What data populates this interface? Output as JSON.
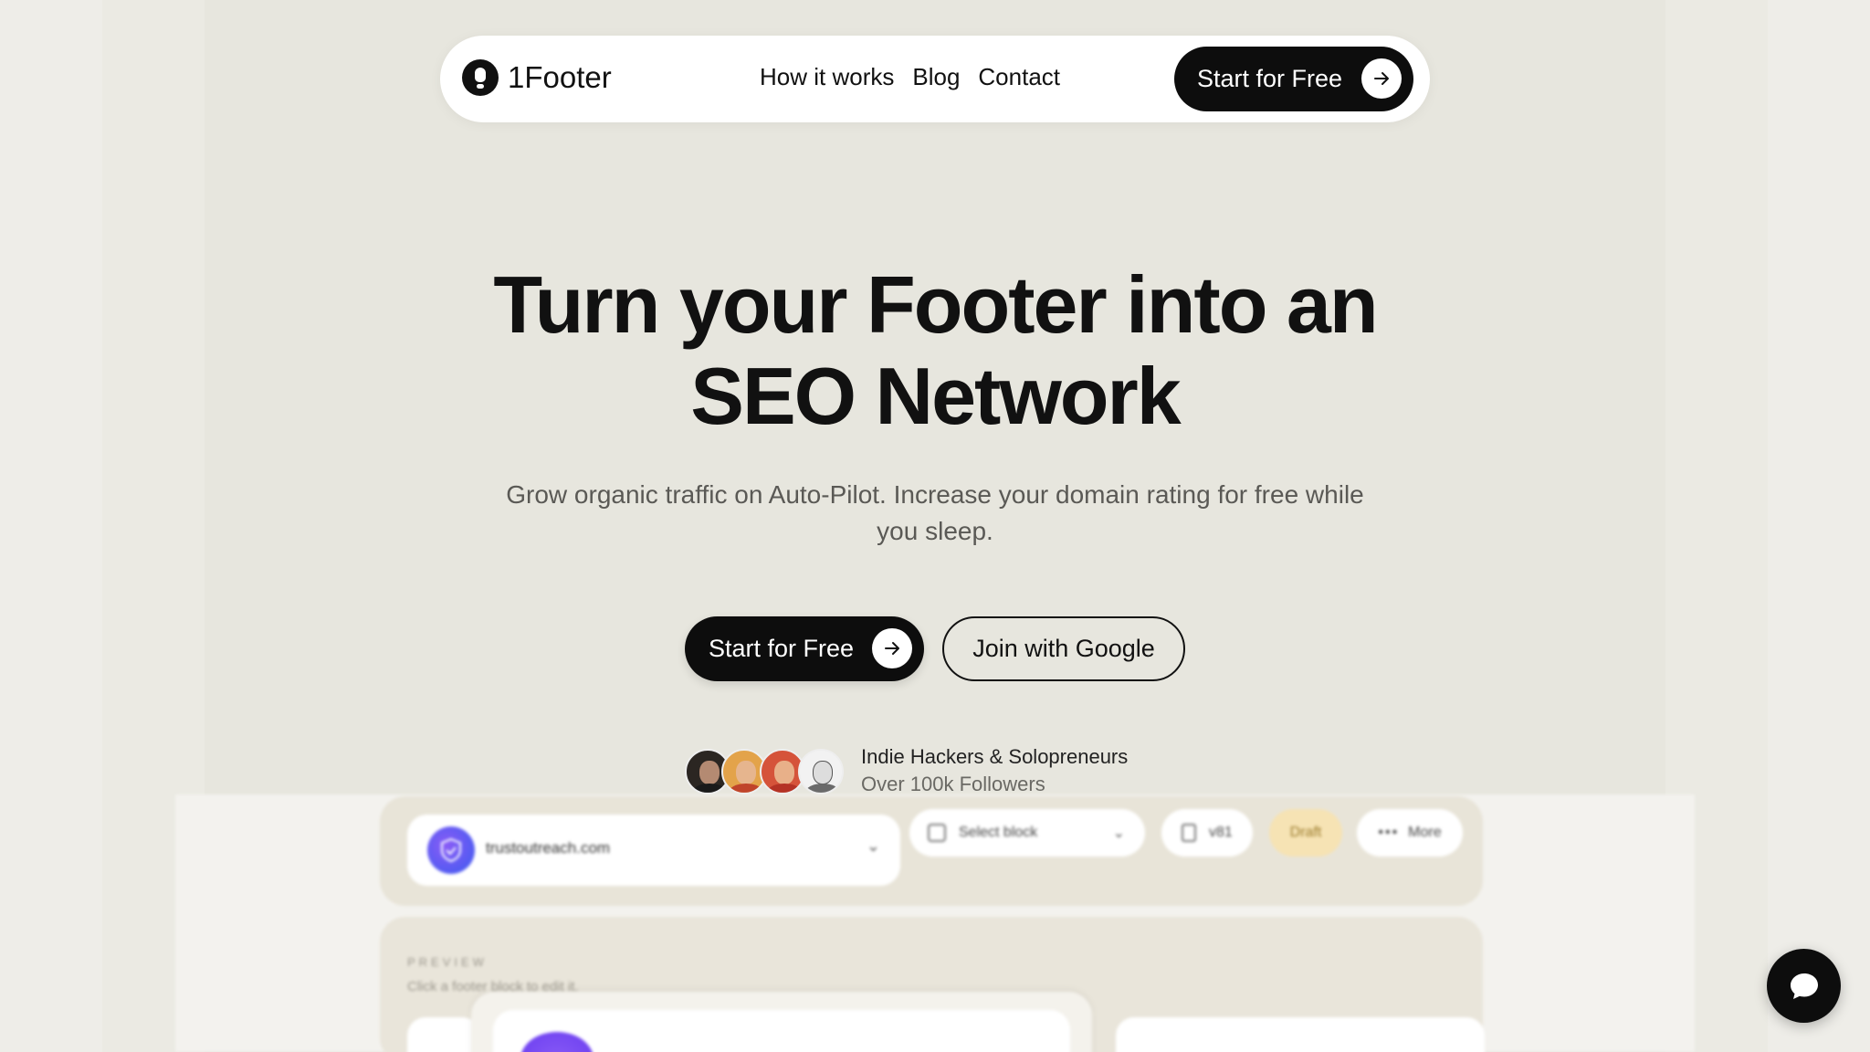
{
  "nav": {
    "logo_text": "1Footer",
    "links": [
      "How it works",
      "Blog",
      "Contact"
    ],
    "cta_label": "Start for Free"
  },
  "hero": {
    "title_line1": "Turn your Footer into an",
    "title_line2": "SEO Network",
    "subtitle_line1": "Grow organic traffic on Auto-Pilot. Increase your domain rating for free while",
    "subtitle_line2": "you sleep.",
    "primary_cta": "Start for Free",
    "secondary_cta": "Join with Google"
  },
  "social_proof": {
    "line1": "Indie Hackers & Solopreneurs",
    "line2": "Over 100k Followers"
  },
  "preview": {
    "site_name": "trustoutreach.com",
    "select_block": "Select block",
    "version": "v81",
    "status": "Draft",
    "more": "More",
    "label": "PREVIEW",
    "hint": "Click a footer block to edit it."
  },
  "colors": {
    "primary": "#0d0d0d",
    "background": "#ecebe5",
    "accent_purple": "#8a5cf6",
    "draft_badge": "#f6e3b4"
  },
  "icons": [
    "logo-icon",
    "arrow-right-icon",
    "chevron-down-icon",
    "shield-icon",
    "grid-icon",
    "document-icon",
    "dots-icon",
    "chat-icon"
  ]
}
